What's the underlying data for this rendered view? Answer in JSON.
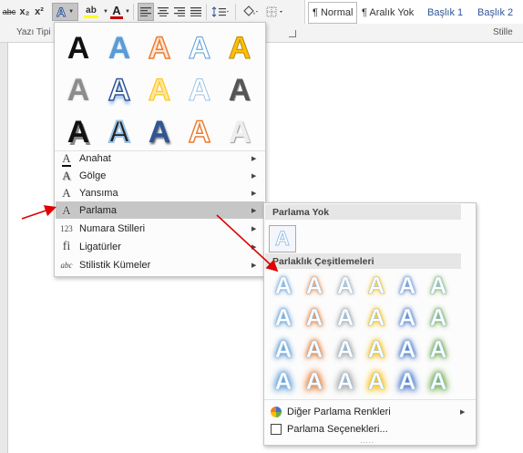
{
  "ribbon": {
    "strike_label": "abc",
    "sub_label": "x₂",
    "super_label": "x²",
    "text_effects_label": "A",
    "highlight_label": "ab",
    "font_color_label": "A",
    "group_font_label": "Yazı Tipi",
    "group_styles_label": "Stille",
    "styles": [
      "¶ Normal",
      "¶ Aralık Yok",
      "Başlık 1",
      "Başlık 2"
    ],
    "colors": {
      "font_red": "#c00000",
      "highlight_yellow": "#ffff00",
      "accent_blue": "#4472c4"
    }
  },
  "text_effects_menu": {
    "gallery_glyph": "A",
    "items": [
      {
        "label": "Anahat",
        "icon": "outline-icon"
      },
      {
        "label": "Gölge",
        "icon": "shadow-icon"
      },
      {
        "label": "Yansıma",
        "icon": "reflection-icon"
      },
      {
        "label": "Parlama",
        "icon": "glow-icon"
      },
      {
        "label": "Numara Stilleri",
        "icon": "number-styles-icon"
      },
      {
        "label": "Ligatürler",
        "icon": "ligature-icon"
      },
      {
        "label": "Stilistik Kümeler",
        "icon": "stylistic-sets-icon"
      }
    ],
    "icon_glyphs": {
      "numbers": "123",
      "ligature": "fi",
      "stylistic": "abc"
    }
  },
  "glow_menu": {
    "no_glow_label": "Parlama Yok",
    "variations_label": "Parlaklık Çeşitlemeleri",
    "glyph": "A",
    "glow_colors": [
      "#5b9bd5",
      "#ed7d31",
      "#a5a5a5",
      "#ffc000",
      "#4472c4",
      "#70ad47"
    ],
    "more_colors_label": "Diğer Parlama Renkleri",
    "options_label": "Parlama Seçenekleri...",
    "dots": "....."
  }
}
